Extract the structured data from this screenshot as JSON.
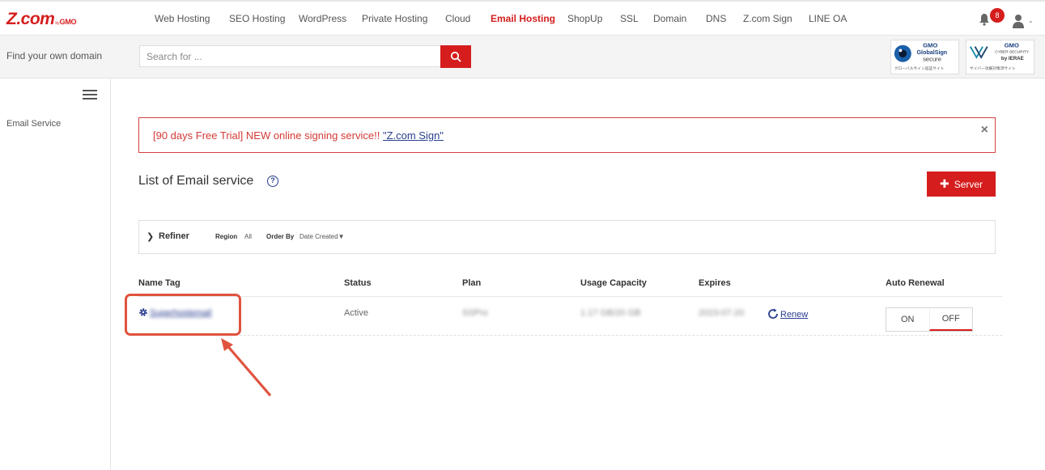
{
  "nav": {
    "logo_main": "Z.com",
    "logo_by": "by",
    "logo_gmo": "GMO",
    "items": [
      {
        "label": "Web Hosting",
        "active": false
      },
      {
        "label": "SEO Hosting",
        "active": false
      },
      {
        "label": "WordPress",
        "active": false
      },
      {
        "label": "Private Hosting",
        "active": false
      },
      {
        "label": "Cloud",
        "active": false
      },
      {
        "label": "Email Hosting",
        "active": true
      },
      {
        "label": "ShopUp",
        "active": false
      },
      {
        "label": "SSL",
        "active": false
      },
      {
        "label": "Domain",
        "active": false
      },
      {
        "label": "DNS",
        "active": false
      },
      {
        "label": "Z.com Sign",
        "active": false
      },
      {
        "label": "LINE OA",
        "active": false
      }
    ],
    "notification_count": "8"
  },
  "domain_search": {
    "label": "Find your own domain",
    "placeholder": "Search for ..."
  },
  "sidebar": {
    "items": [
      {
        "label": "Email Service"
      }
    ]
  },
  "alert": {
    "text": "[90 days Free Trial] NEW online signing service!! ",
    "link_text": "\"Z.com Sign\"",
    "close": "×"
  },
  "main": {
    "title": "List of Email service",
    "help": "?",
    "add_button": "Server"
  },
  "refiner": {
    "label": "Refiner",
    "region_label": "Region",
    "region_value": "All",
    "order_label": "Order By",
    "order_value": "Date Created▼"
  },
  "table": {
    "headers": [
      "Name Tag",
      "Status",
      "Plan",
      "Usage Capacity",
      "Expires",
      "Auto Renewal"
    ],
    "rows": [
      {
        "name_tag": "Superhostemail",
        "status": "Active",
        "plan": "SSPro",
        "usage": "1.17 GB/20 GB",
        "expires": "2023-07-20",
        "renew": "Renew",
        "toggle_on": "ON",
        "toggle_off": "OFF"
      }
    ]
  },
  "colors": {
    "brand_red": "#d51d1d",
    "link_blue": "#2a3e8f",
    "annotation": "#e0533f"
  }
}
